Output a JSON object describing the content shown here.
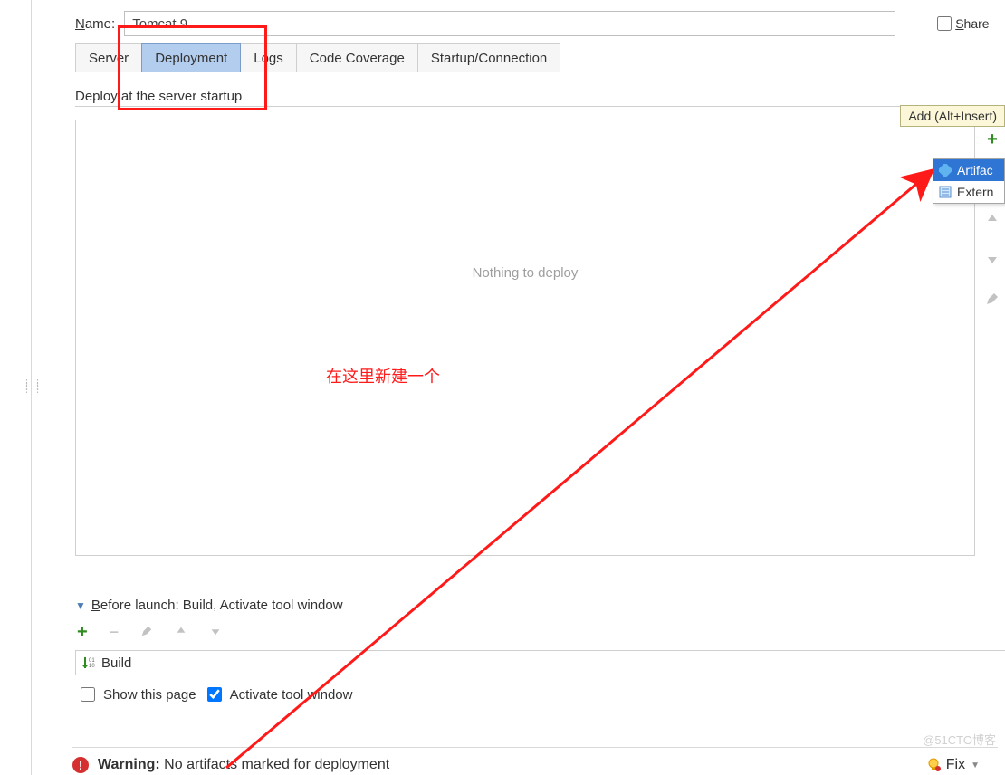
{
  "name_label_prefix": "N",
  "name_label_rest": "ame:",
  "name_value": "Tomcat 9",
  "share_prefix": "S",
  "share_rest": "hare",
  "tabs": {
    "server": "Server",
    "deployment": "Deployment",
    "logs": "Logs",
    "code_coverage": "Code Coverage",
    "startup": "Startup/Connection"
  },
  "deploy_section_title": "Deploy at the server startup",
  "nothing_text": "Nothing to deploy",
  "tooltip_text": "Add (Alt+Insert)",
  "popup": {
    "artifact": "Artifac",
    "external": "Extern"
  },
  "annotation": "在这里新建一个",
  "before_launch": {
    "header_prefix": "B",
    "header_rest": "efore launch: Build, Activate tool window",
    "build_label": "Build"
  },
  "checks": {
    "show_page": "Show this page",
    "activate": "Activate tool window"
  },
  "warning": {
    "label": "Warning:",
    "text": " No artifacts marked for deployment",
    "fix_prefix": "F",
    "fix_rest": "ix"
  },
  "watermark": "@51CTO博客"
}
